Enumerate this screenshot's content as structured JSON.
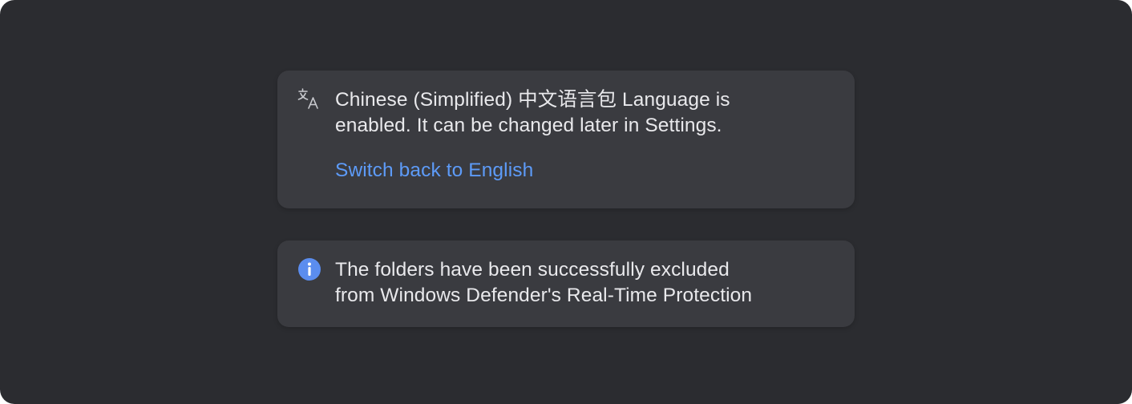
{
  "language_toast": {
    "icon": "translate-icon",
    "message_line1": "Chinese (Simplified) 中文语言包 Language is",
    "message_line2": "enabled. It can be changed later in Settings.",
    "action_label": "Switch back to English"
  },
  "info_toast": {
    "icon": "info-icon",
    "message_line1": "The folders have been successfully excluded",
    "message_line2": "from Windows Defender's Real-Time Protection"
  },
  "colors": {
    "background": "#2b2c30",
    "toast_background": "#3a3b40",
    "text": "#e9e9ec",
    "link": "#5d9bf8",
    "info_icon": "#5b8def"
  }
}
